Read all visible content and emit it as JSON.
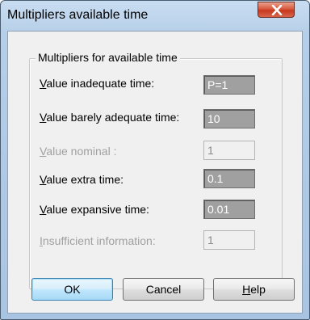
{
  "window": {
    "title": "Multipliers available time"
  },
  "group": {
    "title": "Multipliers for available time"
  },
  "rows": [
    {
      "label_first": "V",
      "label_rest": "alue inadequate time:",
      "value": "P=1",
      "enabled": true
    },
    {
      "label_first": "V",
      "label_rest": "alue barely adequate time:",
      "value": "10",
      "enabled": true
    },
    {
      "label_first": "V",
      "label_rest": "alue nominal :",
      "value": "1",
      "enabled": false
    },
    {
      "label_first": "V",
      "label_rest": "alue extra time:",
      "value": "0.1",
      "enabled": true
    },
    {
      "label_first": "V",
      "label_rest": "alue expansive time:",
      "value": "0.01",
      "enabled": true
    },
    {
      "label_first": "I",
      "label_rest": "nsufficient information:",
      "value": "1",
      "enabled": false
    }
  ],
  "buttons": {
    "ok": {
      "label": "OK"
    },
    "cancel": {
      "label": "Cancel"
    },
    "help": {
      "first": "H",
      "rest": "elp"
    }
  },
  "icons": {
    "close": "close-icon"
  },
  "colors": {
    "title_gradient_top": "#c9ddf1",
    "close_red": "#c7381f",
    "field_dark": "#a0a0a0",
    "disabled_text": "#a0a0a0",
    "default_button_border": "#3c7fb1"
  }
}
